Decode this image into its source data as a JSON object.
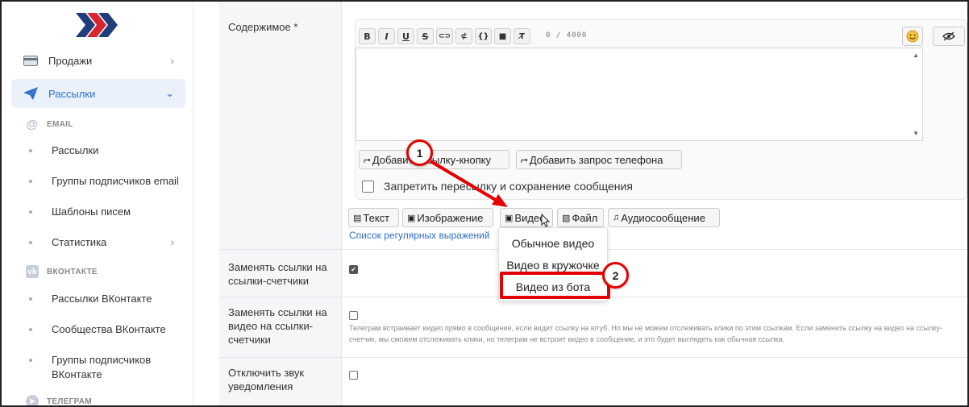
{
  "colors": {
    "accent": "#2e6fc8",
    "annotation": "#e40000",
    "active_bg": "#eaf1fb",
    "logo_red": "#d7262e",
    "logo_blue": "#1f3d7a"
  },
  "sidebar": {
    "items": [
      {
        "label": "Продажи",
        "icon": "wallet-icon"
      },
      {
        "label": "Рассылки",
        "icon": "paper-plane-icon"
      }
    ],
    "email_section": {
      "header": "EMAIL",
      "items": [
        "Рассылки",
        "Группы подписчиков email",
        "Шаблоны писем",
        "Статистика"
      ]
    },
    "vk_section": {
      "header": "ВКОНТАКТЕ",
      "items": [
        "Рассылки ВКонтакте",
        "Сообщества ВКонтакте",
        "Группы подписчиков ВКонтакте"
      ]
    },
    "telegram_section": {
      "header": "ТЕЛЕГРАМ"
    }
  },
  "form": {
    "content_label": "Содержимое *",
    "toolbar": [
      "B",
      "I",
      "U",
      "S",
      "⊂⊃",
      "⊄",
      "{}",
      "■",
      "T̸"
    ],
    "char_count": "0 / 4000",
    "add_buttons": [
      "Добавить ссылку-кнопку",
      "Добавить запрос телефона"
    ],
    "forbid_label": "Запретить пересылку и сохранение сообщения",
    "media_buttons": [
      "Текст",
      "Изображение",
      "Видео",
      "Файл",
      "Аудиосообщение"
    ],
    "regex_link": "Список регулярных выражений",
    "video_menu": [
      "Обычное видео",
      "Видео в кружочке",
      "Видео из бота"
    ],
    "replace_links_label": "Заменять ссылки на ссылки-счетчики",
    "replace_video_label": "Заменять ссылки на видео на ссылки-счетчики",
    "replace_video_hint": "Телеграм встраивает видео прямо в сообщение, если видит ссылку на ютуб. Но мы не можем отслеживать клики по этим ссылкам. Если заменить ссылку на видео на ссылку-счетчик, мы сможем отслеживать клики, но телеграм не встроит видео в сообщение, и это будет выглядеть как обычная ссылка.",
    "mute_label": "Отключить звук уведомления"
  },
  "annotations": {
    "step1": "1",
    "step2": "2"
  }
}
